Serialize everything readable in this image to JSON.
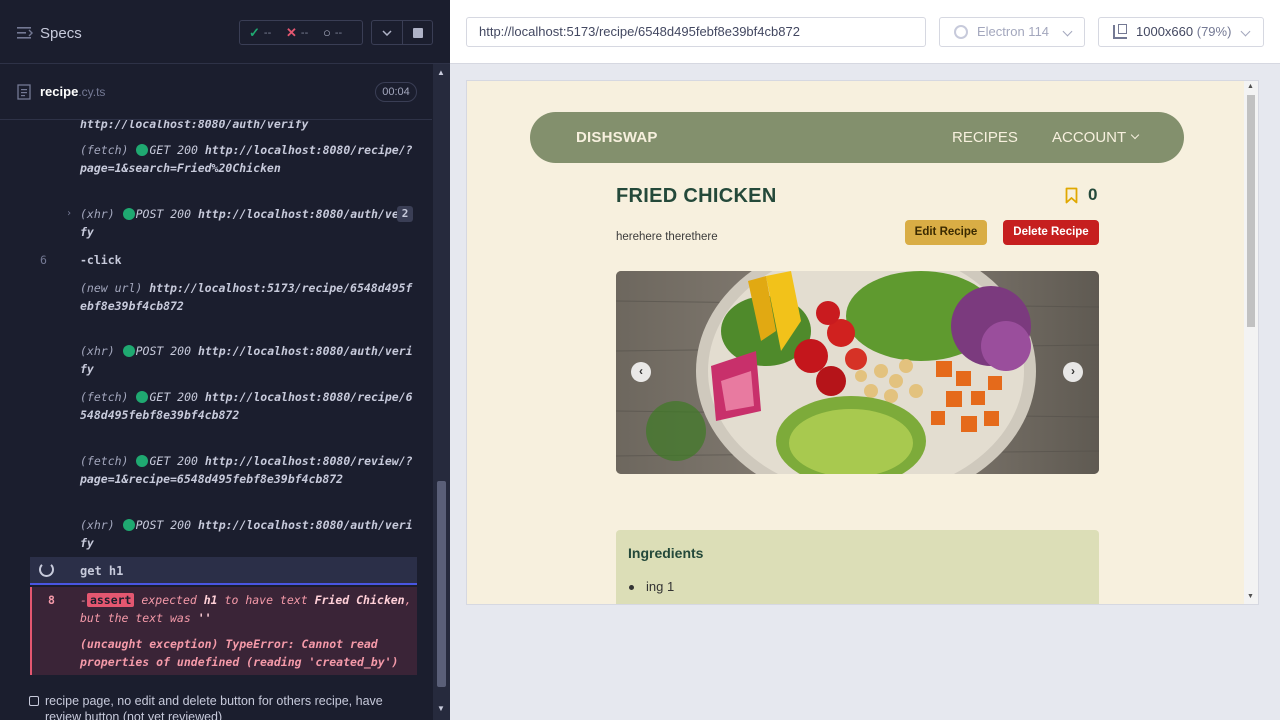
{
  "reporter": {
    "title": "Specs",
    "stats": {
      "passed": "--",
      "failed": "--",
      "pending": "--"
    },
    "file": {
      "name": "recipe",
      "ext": ".cy.ts",
      "duration": "00:04"
    },
    "commands": [
      {
        "url": "http://localhost:8080/auth/verify"
      },
      {
        "type": "(fetch)",
        "method": "GET 200",
        "url": "http://localhost:8080/recipe/?page=1&search=Fried%20Chicken"
      },
      {
        "type": "(xhr)",
        "method": "POST 200",
        "url": "http://localhost:8080/auth/verify",
        "count": "2"
      },
      {
        "num": "6",
        "label": "-click"
      },
      {
        "type": "(new url)",
        "url": "http://localhost:5173/recipe/6548d495febf8e39bf4cb872"
      },
      {
        "type": "(xhr)",
        "method": "POST 200",
        "url": "http://localhost:8080/auth/verify"
      },
      {
        "type": "(fetch)",
        "method": "GET 200",
        "url": "http://localhost:8080/recipe/6548d495febf8e39bf4cb872"
      },
      {
        "type": "(fetch)",
        "method": "GET 200",
        "url": "http://localhost:8080/review/?page=1&recipe=6548d495febf8e39bf4cb872"
      },
      {
        "type": "(xhr)",
        "method": "POST 200",
        "url": "http://localhost:8080/auth/verify"
      }
    ],
    "get_cmd": {
      "label": "get",
      "selector": "h1"
    },
    "failure": {
      "num": "8",
      "dash": "-",
      "badge": "assert",
      "t1": "expected",
      "sel": "h1",
      "t2": "to have text",
      "expected": "Fried Chicken",
      "t3": ", but the text was",
      "actual": "''",
      "error": "(uncaught exception)  TypeError: Cannot read properties of undefined (reading 'created_by')"
    },
    "next_test": "recipe page, no edit and delete button for others recipe, have review button (not yet reviewed)"
  },
  "toolbar": {
    "url": "http://localhost:5173/recipe/6548d495febf8e39bf4cb872",
    "browser": "Electron 114",
    "viewport": "1000x660",
    "scale": "(79%)"
  },
  "app": {
    "brand": "DISHSWAP",
    "nav": {
      "recipes": "RECIPES",
      "account": "ACCOUNT"
    },
    "recipe": {
      "title": "FRIED CHICKEN",
      "bookmarks": "0",
      "description": "herehere therethere",
      "edit_label": "Edit Recipe",
      "delete_label": "Delete Recipe",
      "carousel_prev": "‹",
      "carousel_next": "›"
    },
    "ingredients": {
      "title": "Ingredients",
      "items": [
        "ing 1"
      ]
    }
  },
  "colors": {
    "reporter_bg": "#1b1e2e",
    "pass": "#1fa971",
    "fail": "#e45770",
    "nav_green": "#83906d",
    "page_cream": "#f7f0de",
    "edit_yellow": "#d9ad45",
    "delete_red": "#c61f1f"
  }
}
